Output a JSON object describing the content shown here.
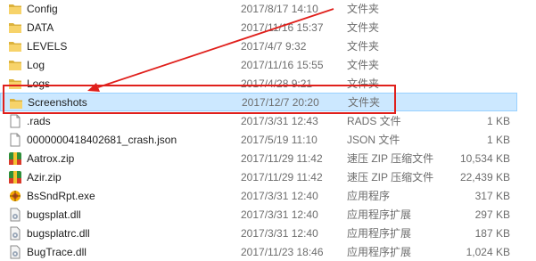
{
  "annotation_color": "#e0201c",
  "selection_color": "#cce8ff",
  "files": [
    {
      "name": "Config",
      "date": "2017/8/17 14:10",
      "type": "文件夹",
      "size": "",
      "icon": "folder-icon",
      "selected": false
    },
    {
      "name": "DATA",
      "date": "2017/11/16 15:37",
      "type": "文件夹",
      "size": "",
      "icon": "folder-icon",
      "selected": false
    },
    {
      "name": "LEVELS",
      "date": "2017/4/7 9:32",
      "type": "文件夹",
      "size": "",
      "icon": "folder-icon",
      "selected": false
    },
    {
      "name": "Log",
      "date": "2017/11/16 15:55",
      "type": "文件夹",
      "size": "",
      "icon": "folder-icon",
      "selected": false
    },
    {
      "name": "Logs",
      "date": "2017/4/28 9:21",
      "type": "文件夹",
      "size": "",
      "icon": "folder-icon",
      "selected": false
    },
    {
      "name": "Screenshots",
      "date": "2017/12/7 20:20",
      "type": "文件夹",
      "size": "",
      "icon": "folder-icon",
      "selected": true
    },
    {
      "name": ".rads",
      "date": "2017/3/31 12:43",
      "type": "RADS 文件",
      "size": "1 KB",
      "icon": "file-icon",
      "selected": false
    },
    {
      "name": "0000000418402681_crash.json",
      "date": "2017/5/19 11:10",
      "type": "JSON 文件",
      "size": "1 KB",
      "icon": "file-icon",
      "selected": false
    },
    {
      "name": "Aatrox.zip",
      "date": "2017/11/29 11:42",
      "type": "速压 ZIP 压缩文件",
      "size": "10,534 KB",
      "icon": "zip-archive-icon",
      "selected": false
    },
    {
      "name": "Azir.zip",
      "date": "2017/11/29 11:42",
      "type": "速压 ZIP 压缩文件",
      "size": "22,439 KB",
      "icon": "zip-archive-icon",
      "selected": false
    },
    {
      "name": "BsSndRpt.exe",
      "date": "2017/3/31 12:40",
      "type": "应用程序",
      "size": "317 KB",
      "icon": "exe-icon",
      "selected": false
    },
    {
      "name": "bugsplat.dll",
      "date": "2017/3/31 12:40",
      "type": "应用程序扩展",
      "size": "297 KB",
      "icon": "dll-icon",
      "selected": false
    },
    {
      "name": "bugsplatrc.dll",
      "date": "2017/3/31 12:40",
      "type": "应用程序扩展",
      "size": "187 KB",
      "icon": "dll-icon",
      "selected": false
    },
    {
      "name": "BugTrace.dll",
      "date": "2017/11/23 18:46",
      "type": "应用程序扩展",
      "size": "1,024 KB",
      "icon": "dll-icon",
      "selected": false
    }
  ]
}
